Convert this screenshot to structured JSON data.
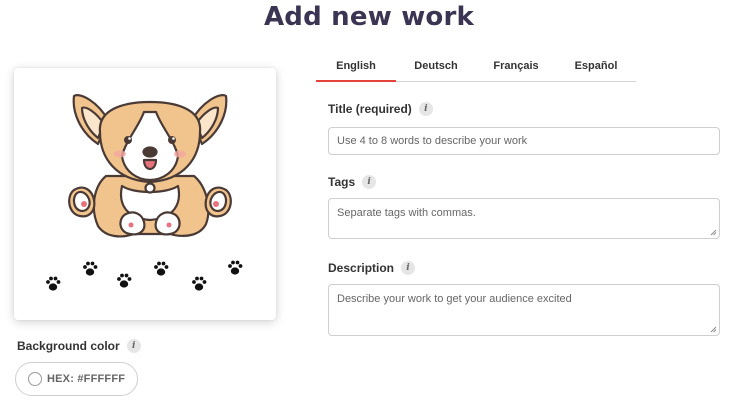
{
  "page": {
    "title": "Add new work"
  },
  "preview": {
    "image_description_icon": "corgi-illustration"
  },
  "background_color": {
    "label": "Background color",
    "info_icon": "i",
    "hex_label": "HEX: #FFFFFF",
    "swatch_color": "#FFFFFF"
  },
  "tabs": [
    {
      "label": "English",
      "active": true
    },
    {
      "label": "Deutsch",
      "active": false
    },
    {
      "label": "Français",
      "active": false
    },
    {
      "label": "Español",
      "active": false
    }
  ],
  "fields": {
    "title": {
      "label": "Title (required)",
      "placeholder": "Use 4 to 8 words to describe your work"
    },
    "tags": {
      "label": "Tags",
      "placeholder": "Separate tags with commas."
    },
    "description": {
      "label": "Description",
      "placeholder": "Describe your work to get your audience excited"
    }
  },
  "colors": {
    "title": "#3b3452",
    "tab_accent": "#e1443a",
    "corgi_fur": "#f2c48d",
    "corgi_outline": "#4a3a35"
  }
}
